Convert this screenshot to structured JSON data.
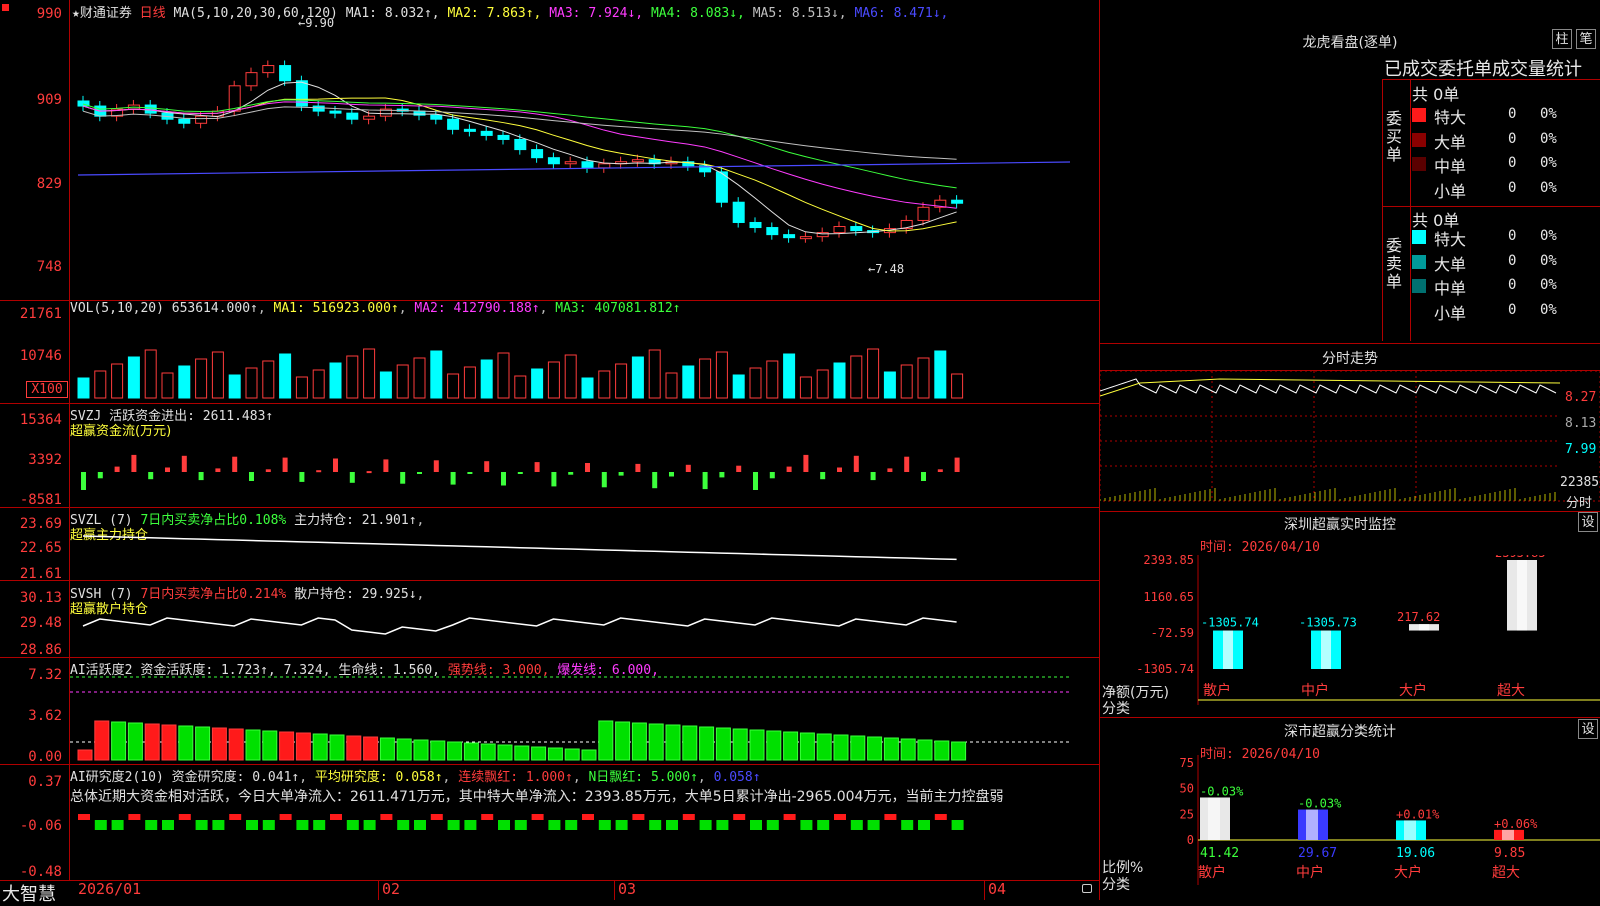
{
  "left_corner_icon": "red-square-marker",
  "left_axis": {
    "price": [
      "990",
      "909",
      "829",
      "748"
    ],
    "volume": [
      "21761",
      "10746"
    ],
    "volume_unit": "X100",
    "svzj": [
      "15364",
      "3392",
      "-8581"
    ],
    "svzl": [
      "23.69",
      "22.65",
      "21.61"
    ],
    "svsh": [
      "30.13",
      "29.48",
      "28.86"
    ],
    "ai_activity": [
      "7.32",
      "3.62",
      "0.00"
    ],
    "ai_research": [
      "0.37",
      "-0.06",
      "-0.48"
    ]
  },
  "price_panel": {
    "title": "★财通证券",
    "period": "日线",
    "ma_head": "MA(5,10,20,30,60,120)",
    "ma": [
      {
        "label": "MA1:",
        "value": "8.032↑",
        "color": "#e0e0e0"
      },
      {
        "label": "MA2:",
        "value": "7.863↑",
        "color": "#ffff3c"
      },
      {
        "label": "MA3:",
        "value": "7.924↓",
        "color": "#ff3cff"
      },
      {
        "label": "MA4:",
        "value": "8.083↓",
        "color": "#3cff3c"
      },
      {
        "label": "MA5:",
        "value": "8.513↓",
        "color": "#c0c0c0"
      },
      {
        "label": "MA6:",
        "value": "8.471↓",
        "color": "#4a4aff"
      }
    ],
    "high_marker": "9.90",
    "low_marker": "7.48"
  },
  "vol_panel": {
    "head": "VOL(5,10,20)",
    "value": "653614.000↑",
    "ma1": "MA1: 516923.000↑",
    "ma2": "MA2: 412790.188↑",
    "ma3": "MA3: 407081.812↑"
  },
  "svzj_panel": {
    "head": "SVZJ  活跃资金进出: 2611.483↑",
    "sub": "超赢资金流(万元)"
  },
  "svzl_panel": {
    "head": "SVZL (7)",
    "desc": "7日内买卖净占比0.108%",
    "hold": "主力持仓: 21.901↑",
    "sub": "超赢主力持仓"
  },
  "svsh_panel": {
    "head": "SVSH (7)",
    "desc": "7日内买卖净占比0.214%",
    "hold": "散户持仓: 29.925↓",
    "sub": "超赢散户持仓"
  },
  "ai_activity_panel": {
    "head": "AI活跃度2",
    "activity": "资金活跃度: 1.723↑, 7.324,",
    "life": "生命线: 1.560,",
    "strong": "强势线: 3.000,",
    "burst": "爆发线: 6.000,"
  },
  "ai_research_panel": {
    "head": "AI研究度2(10)",
    "research": "资金研究度: 0.041↑",
    "avg": "平均研究度: 0.058↑",
    "streak": "连续飘红: 1.000↑",
    "nday": "N日飘红: 5.000↑",
    "last": "0.058↑",
    "summary": "总体近期大资金相对活跃，今日大单净流入：2611.471万元，其中特大单净流入：2393.85万元，大单5日累计净出-2965.004万元，当前主力控盘弱"
  },
  "x_axis": [
    "2026/01",
    "02",
    "03",
    "04"
  ],
  "footer": {
    "brand": "大智慧"
  },
  "dragon_tiger": {
    "title": "龙虎看盘(逐单)",
    "btn_col": "柱",
    "btn_bi": "笔",
    "tabs": "已成交委托单成交量统计",
    "buy_group": "委买单",
    "buy_total": "共 0单",
    "sell_group": "委卖单",
    "sell_total": "共 0单",
    "buy_rows": [
      {
        "label": "特大",
        "count": "0",
        "pct": "0%",
        "color": "#ff1a1a"
      },
      {
        "label": "大单",
        "count": "0",
        "pct": "0%",
        "color": "#8a0000"
      },
      {
        "label": "中单",
        "count": "0",
        "pct": "0%",
        "color": "#5a0000"
      },
      {
        "label": "小单",
        "count": "0",
        "pct": "0%",
        "color": ""
      }
    ],
    "sell_rows": [
      {
        "label": "特大",
        "count": "0",
        "pct": "0%",
        "color": "#00ffff"
      },
      {
        "label": "大单",
        "count": "0",
        "pct": "0%",
        "color": "#009a9a"
      },
      {
        "label": "中单",
        "count": "0",
        "pct": "0%",
        "color": "#007070"
      },
      {
        "label": "小单",
        "count": "0",
        "pct": "0%",
        "color": ""
      }
    ]
  },
  "intraday": {
    "title": "分时走势",
    "prices": [
      "8.27",
      "8.13",
      "7.99"
    ],
    "volume": "22385",
    "unit": "分时"
  },
  "monitor": {
    "title": "深圳超赢实时监控",
    "btn": "设",
    "time": "时间: 2026/04/10",
    "y_ticks": [
      "2393.85",
      "1160.65",
      "-72.59",
      "-1305.74"
    ],
    "y_label": "净额(万元)",
    "x_label": "分类",
    "chart_data": {
      "type": "bar",
      "categories": [
        "散户",
        "中户",
        "大户",
        "超大"
      ],
      "values": [
        -1305.74,
        -1305.73,
        217.62,
        2393.85
      ],
      "value_labels": [
        "-1305.74",
        "-1305.73",
        "217.62",
        "2393.85"
      ],
      "ylim": [
        -1305.74,
        2393.85
      ]
    }
  },
  "classify": {
    "title": "深市超赢分类统计",
    "btn": "设",
    "time": "时间: 2026/04/10",
    "y_ticks": [
      "75",
      "50",
      "25",
      "0"
    ],
    "y_label": "比例%",
    "x_label": "分类",
    "chart_data": {
      "type": "bar",
      "categories": [
        "散户",
        "中户",
        "大户",
        "超大"
      ],
      "values": [
        41.42,
        29.67,
        19.06,
        9.85
      ],
      "value_labels": [
        "41.42",
        "29.67",
        "19.06",
        "9.85"
      ],
      "changes": [
        "-0.03%",
        "-0.03%",
        "+0.01%",
        "+0.06%"
      ],
      "ylim": [
        0,
        75
      ]
    }
  }
}
